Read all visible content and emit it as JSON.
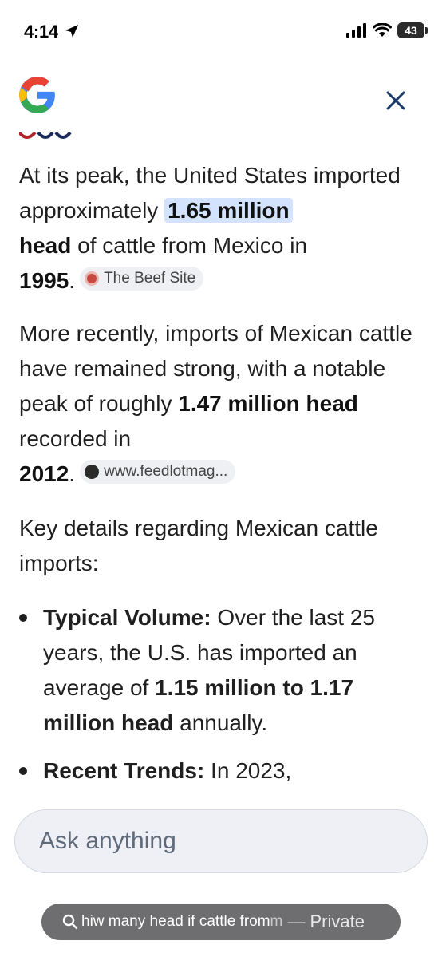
{
  "status_bar": {
    "time": "4:14",
    "battery": "43"
  },
  "content": {
    "para1": {
      "t1": "At its peak, the United States imported approximately ",
      "highlight": "1.65 million",
      "b1": "head",
      "t2": " of cattle from Mexico in ",
      "b2": "1995",
      "t3": ".",
      "source": "The Beef Site"
    },
    "para2": {
      "t1": "More recently, imports of Mexican cattle have remained strong, with a notable peak of roughly ",
      "b1": "1.47 million head",
      "t2": " recorded in ",
      "b2": "2012",
      "t3": ".",
      "source": "www.feedlotmag..."
    },
    "para3": "Key details regarding Mexican cattle imports:",
    "bullets": [
      {
        "label": "Typical Volume:",
        "t1": " Over the last 25 years, the U.S. has imported an average of ",
        "b1": "1.15 million to 1.17 million head",
        "t2": " annually."
      },
      {
        "label": "Recent Trends:",
        "t1": " In 2023,"
      }
    ]
  },
  "ask": {
    "placeholder": "Ask anything"
  },
  "url_bar": {
    "query": "hiw many head if cattle from ",
    "query_fade": "m",
    "private": "— Private"
  }
}
